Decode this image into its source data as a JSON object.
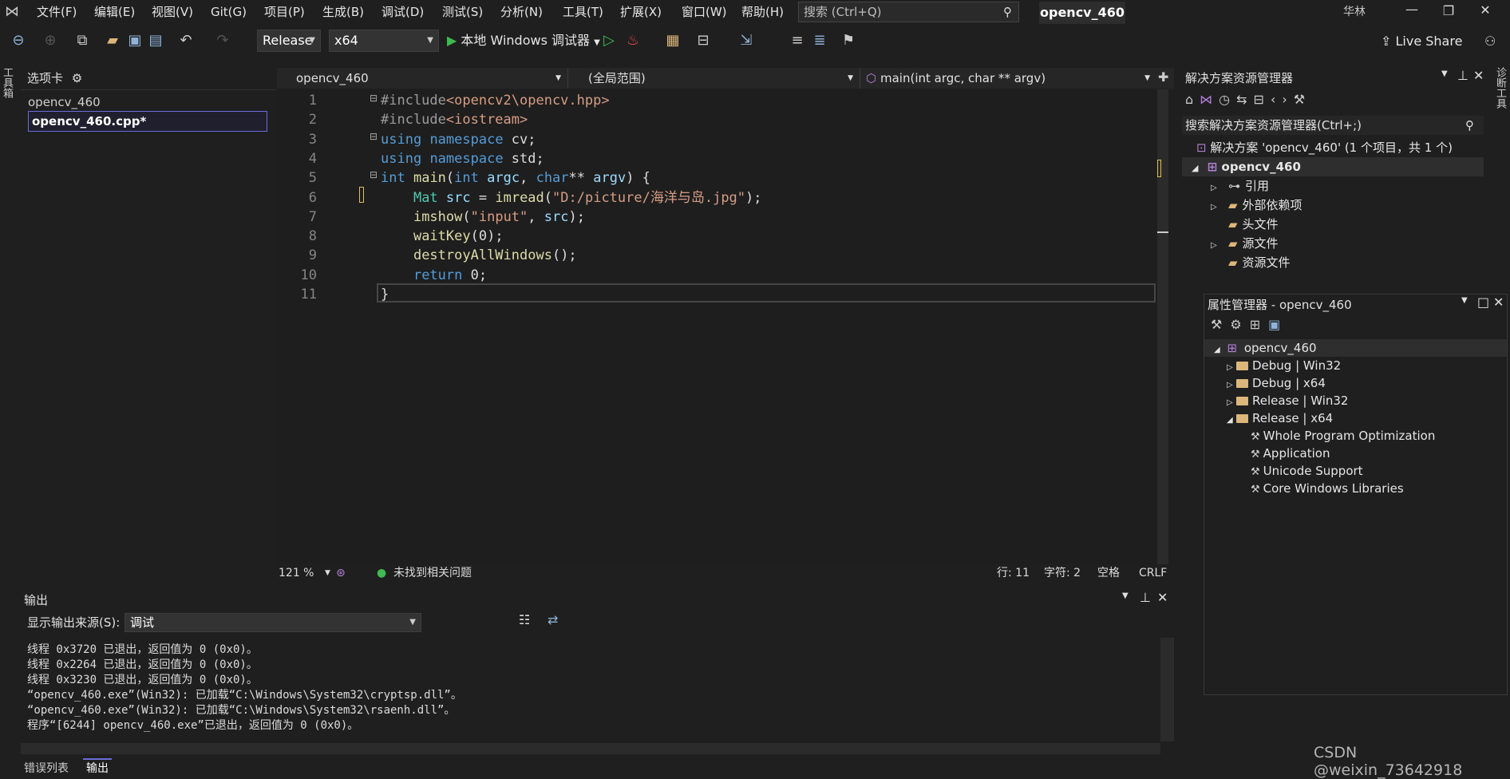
{
  "menu": [
    "文件(F)",
    "编辑(E)",
    "视图(V)",
    "Git(G)",
    "项目(P)",
    "生成(B)",
    "调试(D)",
    "测试(S)",
    "分析(N)",
    "工具(T)",
    "扩展(X)",
    "窗口(W)",
    "帮助(H)"
  ],
  "search_placeholder": "搜索 (Ctrl+Q)",
  "solution_title": "opencv_460",
  "user_initials": "华林",
  "toolbar": {
    "config": "Release",
    "platform": "x64",
    "run_label": "本地 Windows 调试器",
    "live_share": "Live Share"
  },
  "left_rail": "工具箱",
  "right_rail": "诊断工具",
  "tabs_panel": {
    "title": "选项卡",
    "project": "opencv_460",
    "file": "opencv_460.cpp*"
  },
  "nav": {
    "project": "opencv_460",
    "scope": "(全局范围)",
    "member": "main(int argc, char ** argv)"
  },
  "code": {
    "line_numbers": [
      "1",
      "2",
      "3",
      "4",
      "5",
      "6",
      "7",
      "8",
      "9",
      "10",
      "11"
    ],
    "lines": [
      [
        {
          "t": "#include",
          "c": "pp"
        },
        {
          "t": "<opencv2\\opencv.hpp>",
          "c": "inc"
        }
      ],
      [
        {
          "t": "#include",
          "c": "pp"
        },
        {
          "t": "<iostream>",
          "c": "inc"
        }
      ],
      [
        {
          "t": "using",
          "c": "kw"
        },
        {
          "t": " ",
          "c": ""
        },
        {
          "t": "namespace",
          "c": "kw"
        },
        {
          "t": " cv;",
          "c": ""
        }
      ],
      [
        {
          "t": "using",
          "c": "kw"
        },
        {
          "t": " ",
          "c": ""
        },
        {
          "t": "namespace",
          "c": "kw"
        },
        {
          "t": " std;",
          "c": ""
        }
      ],
      [
        {
          "t": "int",
          "c": "kw"
        },
        {
          "t": " ",
          "c": ""
        },
        {
          "t": "main",
          "c": "fn"
        },
        {
          "t": "(",
          "c": ""
        },
        {
          "t": "int",
          "c": "kw"
        },
        {
          "t": " ",
          "c": ""
        },
        {
          "t": "argc",
          "c": "var"
        },
        {
          "t": ", ",
          "c": ""
        },
        {
          "t": "char",
          "c": "kw"
        },
        {
          "t": "** ",
          "c": ""
        },
        {
          "t": "argv",
          "c": "var"
        },
        {
          "t": ") {",
          "c": ""
        }
      ],
      [
        {
          "t": "    ",
          "c": ""
        },
        {
          "t": "Mat",
          "c": "ty"
        },
        {
          "t": " ",
          "c": ""
        },
        {
          "t": "src",
          "c": "var"
        },
        {
          "t": " = ",
          "c": ""
        },
        {
          "t": "imread",
          "c": "fn"
        },
        {
          "t": "(",
          "c": ""
        },
        {
          "t": "\"D:/picture/海洋与岛.jpg\"",
          "c": "st"
        },
        {
          "t": ");",
          "c": ""
        }
      ],
      [
        {
          "t": "    ",
          "c": ""
        },
        {
          "t": "imshow",
          "c": "fn"
        },
        {
          "t": "(",
          "c": ""
        },
        {
          "t": "\"input\"",
          "c": "st"
        },
        {
          "t": ", ",
          "c": ""
        },
        {
          "t": "src",
          "c": "var"
        },
        {
          "t": ");",
          "c": ""
        }
      ],
      [
        {
          "t": "    ",
          "c": ""
        },
        {
          "t": "waitKey",
          "c": "fn"
        },
        {
          "t": "(0);",
          "c": ""
        }
      ],
      [
        {
          "t": "    ",
          "c": ""
        },
        {
          "t": "destroyAllWindows",
          "c": "fn"
        },
        {
          "t": "();",
          "c": ""
        }
      ],
      [
        {
          "t": "    ",
          "c": ""
        },
        {
          "t": "return",
          "c": "kw"
        },
        {
          "t": " 0;",
          "c": ""
        }
      ],
      [
        {
          "t": "}",
          "c": ""
        }
      ]
    ]
  },
  "status": {
    "zoom": "121 %",
    "issues": "未找到相关问题",
    "line": "行: 11",
    "char": "字符: 2",
    "spacing": "空格",
    "eol": "CRLF"
  },
  "output": {
    "title": "输出",
    "source_label": "显示输出来源(S):",
    "source_value": "调试",
    "lines": [
      "线程 0x3720 已退出，返回值为 0 (0x0)。",
      "线程 0x2264 已退出，返回值为 0 (0x0)。",
      "线程 0x3230 已退出，返回值为 0 (0x0)。",
      "“opencv_460.exe”(Win32): 已加载“C:\\Windows\\System32\\cryptsp.dll”。",
      "“opencv_460.exe”(Win32): 已加载“C:\\Windows\\System32\\rsaenh.dll”。",
      "程序“[6244] opencv_460.exe”已退出，返回值为 0 (0x0)。"
    ],
    "bottom_tabs": [
      "错误列表",
      "输出"
    ]
  },
  "solution_explorer": {
    "title": "解决方案资源管理器",
    "search": "搜索解决方案资源管理器(Ctrl+;)",
    "solution": "解决方案 'opencv_460' (1 个项目，共 1 个)",
    "project": "opencv_460",
    "items": [
      "引用",
      "外部依赖项",
      "头文件",
      "源文件",
      "资源文件"
    ]
  },
  "property_manager": {
    "title": "属性管理器 - opencv_460",
    "project": "opencv_460",
    "configs": [
      "Debug | Win32",
      "Debug | x64",
      "Release | Win32",
      "Release | x64"
    ],
    "sheets": [
      "Whole Program Optimization",
      "Application",
      "Unicode Support",
      "Core Windows Libraries"
    ]
  },
  "watermark": "CSDN @weixin_73642918"
}
